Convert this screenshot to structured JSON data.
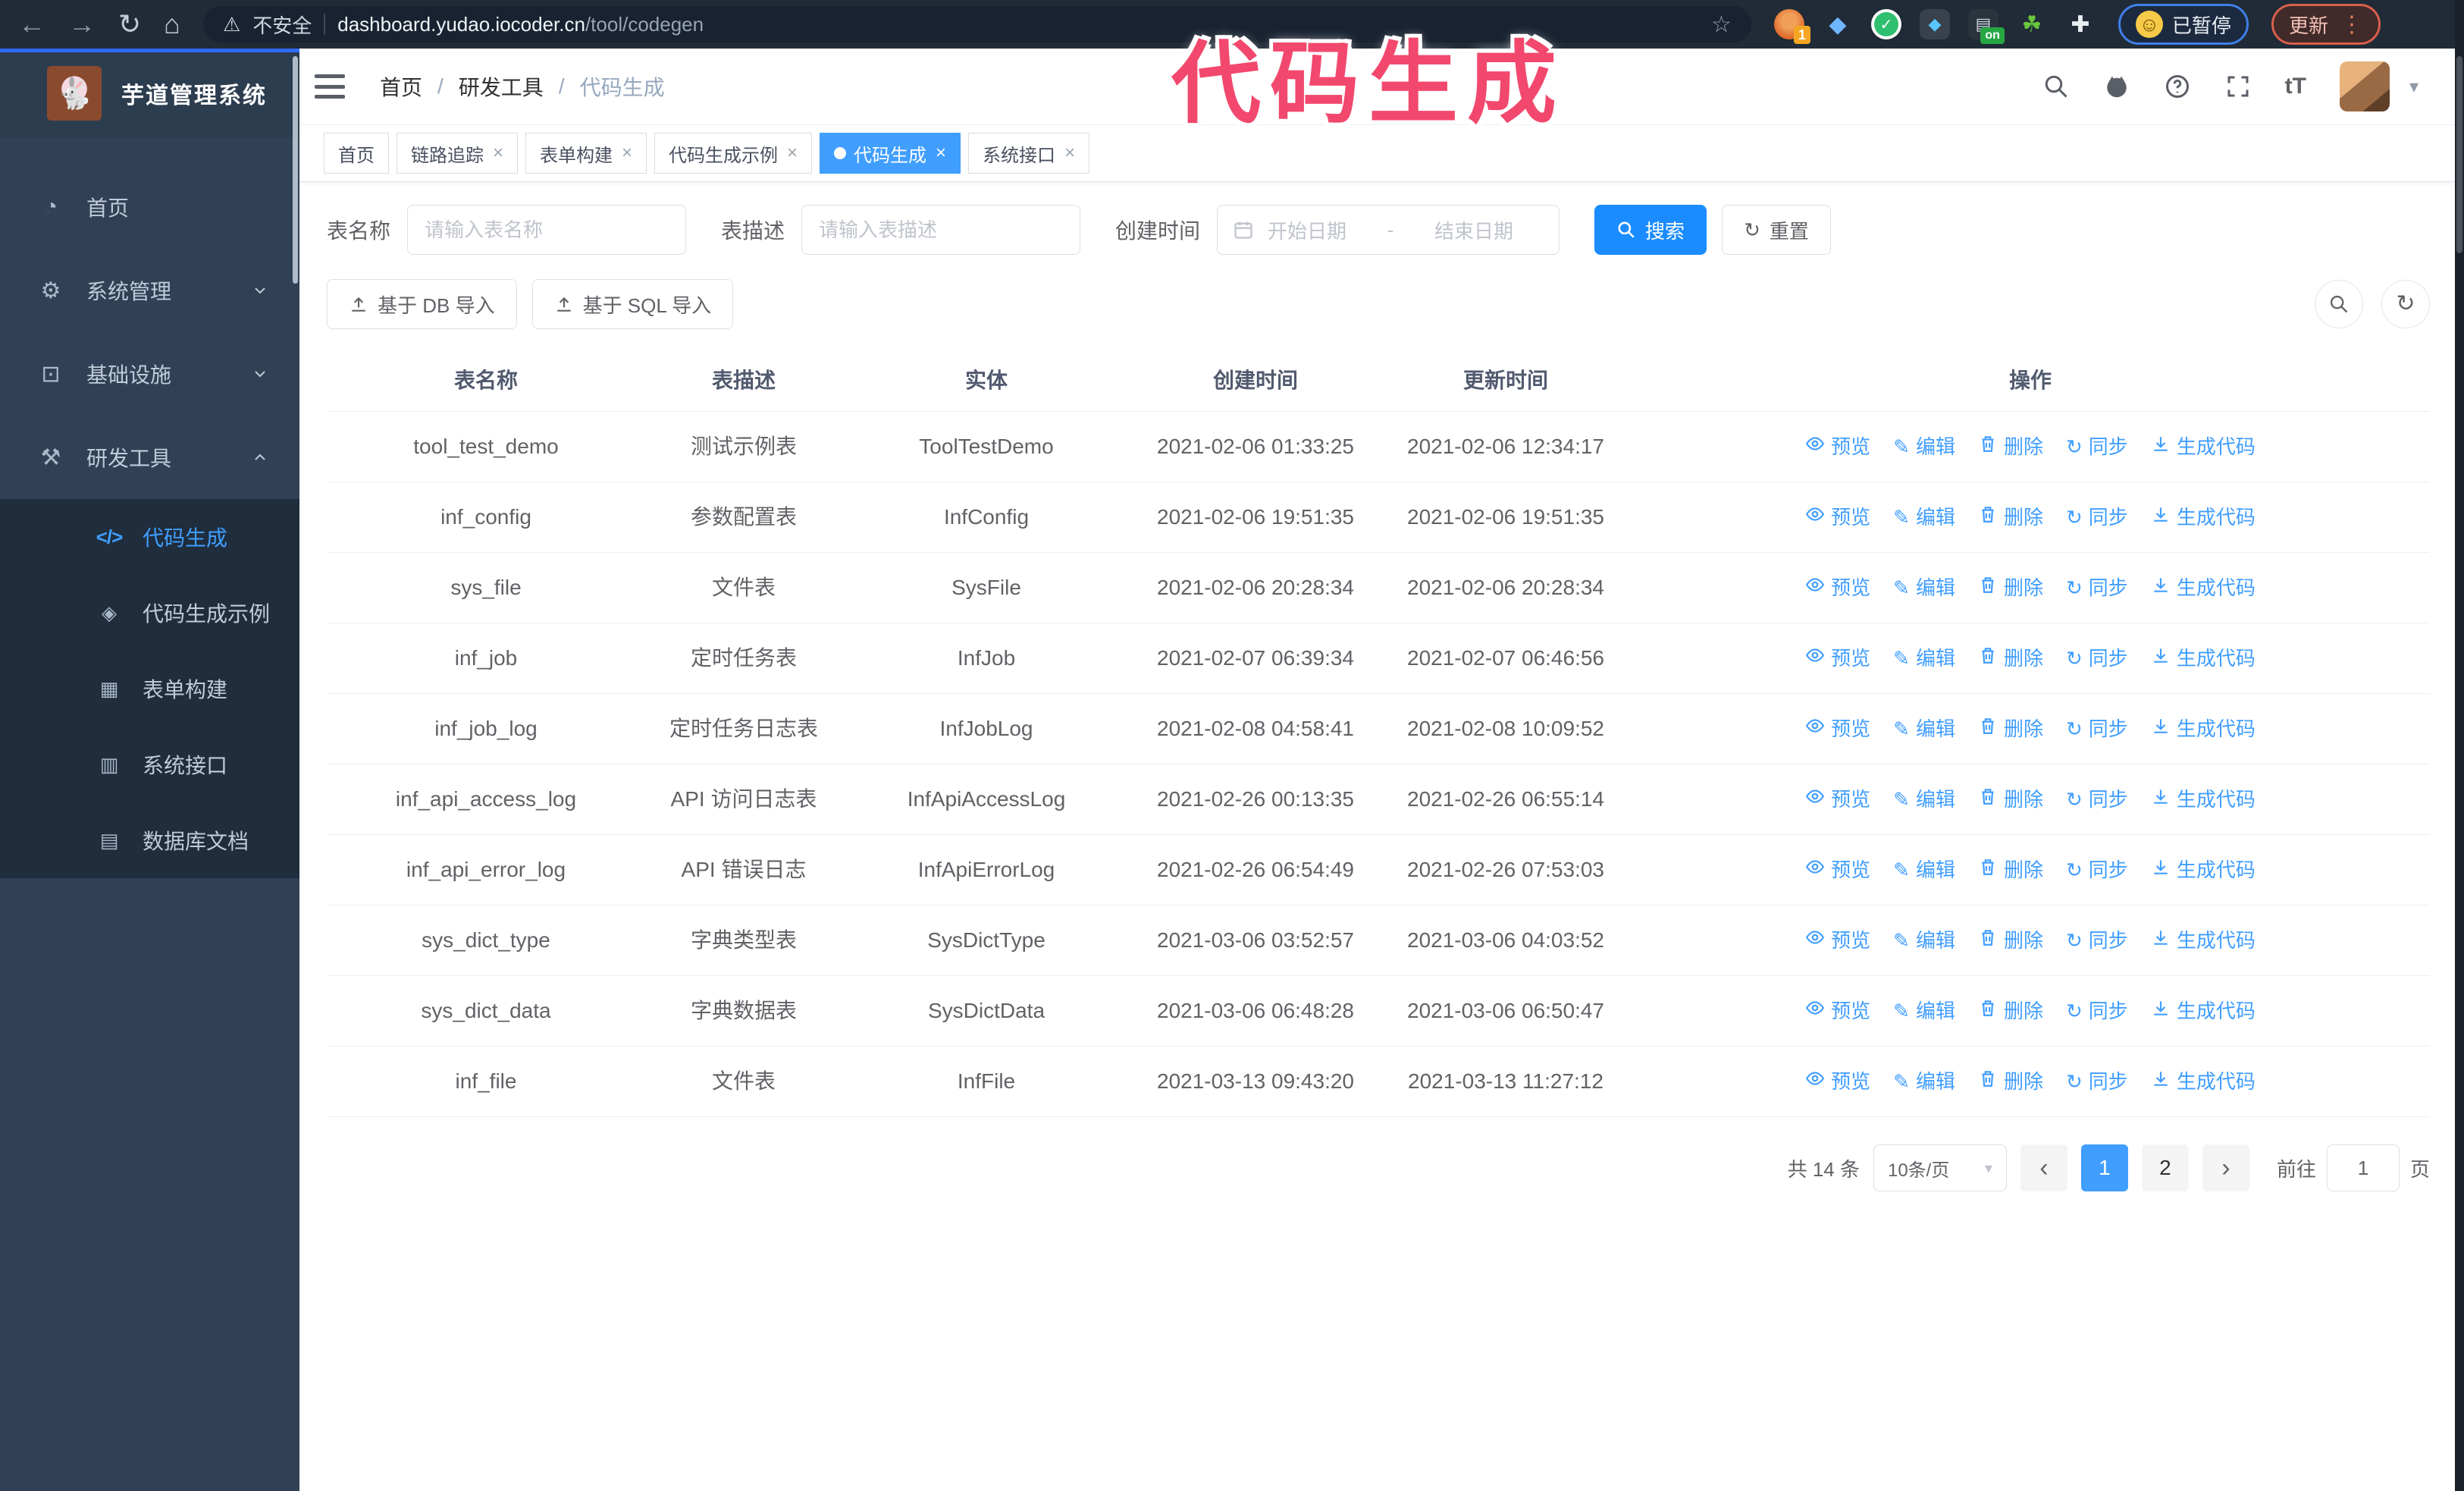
{
  "browser": {
    "security_text": "不安全",
    "url_host": "dashboard.yudao.iocoder.cn",
    "url_path": "/tool/codegen",
    "ext_badge": "1",
    "ext_on_badge": "on",
    "paused_label": "已暂停",
    "update_label": "更新"
  },
  "annotation": {
    "text": "代码生成",
    "color": "#f2486d"
  },
  "sidebar": {
    "logo_title": "芋道管理系统",
    "items": [
      {
        "label": "首页",
        "icon": "dashboard-icon",
        "glyph": "◔",
        "arrow": null,
        "active": false
      },
      {
        "label": "系统管理",
        "icon": "gear-icon",
        "glyph": "⚙",
        "arrow": "down",
        "active": false
      },
      {
        "label": "基础设施",
        "icon": "monitor-icon",
        "glyph": "⊡",
        "arrow": "down",
        "active": false
      },
      {
        "label": "研发工具",
        "icon": "toolbox-icon",
        "glyph": "⚒",
        "arrow": "up",
        "active": false,
        "children": [
          {
            "label": "代码生成",
            "icon": "code-icon",
            "glyph": "</>",
            "active": true
          },
          {
            "label": "代码生成示例",
            "icon": "example-icon",
            "glyph": "◈",
            "active": false
          },
          {
            "label": "表单构建",
            "icon": "form-icon",
            "glyph": "▦",
            "active": false
          },
          {
            "label": "系统接口",
            "icon": "api-icon",
            "glyph": "▥",
            "active": false
          },
          {
            "label": "数据库文档",
            "icon": "database-doc-icon",
            "glyph": "▤",
            "active": false
          }
        ]
      }
    ]
  },
  "navbar": {
    "breadcrumb": [
      "首页",
      "研发工具",
      "代码生成"
    ],
    "separator": "/"
  },
  "tags": [
    {
      "label": "首页",
      "active": false,
      "closable": false
    },
    {
      "label": "链路追踪",
      "active": false,
      "closable": true
    },
    {
      "label": "表单构建",
      "active": false,
      "closable": true
    },
    {
      "label": "代码生成示例",
      "active": false,
      "closable": true
    },
    {
      "label": "代码生成",
      "active": true,
      "closable": true
    },
    {
      "label": "系统接口",
      "active": false,
      "closable": true
    }
  ],
  "search": {
    "name_label": "表名称",
    "name_placeholder": "请输入表名称",
    "desc_label": "表描述",
    "desc_placeholder": "请输入表描述",
    "time_label": "创建时间",
    "start_placeholder": "开始日期",
    "range_separator": "-",
    "end_placeholder": "结束日期",
    "search_label": "搜索",
    "reset_label": "重置"
  },
  "toolbar": {
    "db_import_label": "基于 DB 导入",
    "sql_import_label": "基于 SQL 导入"
  },
  "table": {
    "columns": [
      "表名称",
      "表描述",
      "实体",
      "创建时间",
      "更新时间",
      "操作"
    ],
    "actions": [
      {
        "key": "preview",
        "label": "预览",
        "icon": "eye-icon"
      },
      {
        "key": "edit",
        "label": "编辑",
        "icon": "edit-icon"
      },
      {
        "key": "delete",
        "label": "删除",
        "icon": "trash-icon"
      },
      {
        "key": "sync",
        "label": "同步",
        "icon": "sync-icon"
      },
      {
        "key": "generate-code",
        "label": "生成代码",
        "icon": "download-icon"
      }
    ],
    "rows": [
      {
        "name": "tool_test_demo",
        "desc": "测试示例表",
        "entity": "ToolTestDemo",
        "created": "2021-02-06 01:33:25",
        "updated": "2021-02-06 12:34:17"
      },
      {
        "name": "inf_config",
        "desc": "参数配置表",
        "entity": "InfConfig",
        "created": "2021-02-06 19:51:35",
        "updated": "2021-02-06 19:51:35"
      },
      {
        "name": "sys_file",
        "desc": "文件表",
        "entity": "SysFile",
        "created": "2021-02-06 20:28:34",
        "updated": "2021-02-06 20:28:34"
      },
      {
        "name": "inf_job",
        "desc": "定时任务表",
        "entity": "InfJob",
        "created": "2021-02-07 06:39:34",
        "updated": "2021-02-07 06:46:56"
      },
      {
        "name": "inf_job_log",
        "desc": "定时任务日志表",
        "entity": "InfJobLog",
        "created": "2021-02-08 04:58:41",
        "updated": "2021-02-08 10:09:52"
      },
      {
        "name": "inf_api_access_log",
        "desc": "API 访问日志表",
        "entity": "InfApiAccessLog",
        "created": "2021-02-26 00:13:35",
        "updated": "2021-02-26 06:55:14"
      },
      {
        "name": "inf_api_error_log",
        "desc": "API 错误日志",
        "entity": "InfApiErrorLog",
        "created": "2021-02-26 06:54:49",
        "updated": "2021-02-26 07:53:03"
      },
      {
        "name": "sys_dict_type",
        "desc": "字典类型表",
        "entity": "SysDictType",
        "created": "2021-03-06 03:52:57",
        "updated": "2021-03-06 04:03:52"
      },
      {
        "name": "sys_dict_data",
        "desc": "字典数据表",
        "entity": "SysDictData",
        "created": "2021-03-06 06:48:28",
        "updated": "2021-03-06 06:50:47"
      },
      {
        "name": "inf_file",
        "desc": "文件表",
        "entity": "InfFile",
        "created": "2021-03-13 09:43:20",
        "updated": "2021-03-13 11:27:12"
      }
    ]
  },
  "pagination": {
    "total": "共 14 条",
    "page_size": "10条/页",
    "pages": [
      "1",
      "2"
    ],
    "active_page": "1",
    "goto_label": "前往",
    "goto_value": "1",
    "goto_suffix": "页"
  },
  "colors": {
    "accent": "#409eff",
    "annotation_pink": "#f2486d",
    "sidebar_bg": "#304156",
    "submenu_bg": "#1f2d3d",
    "chrome_bg": "#202b37"
  }
}
